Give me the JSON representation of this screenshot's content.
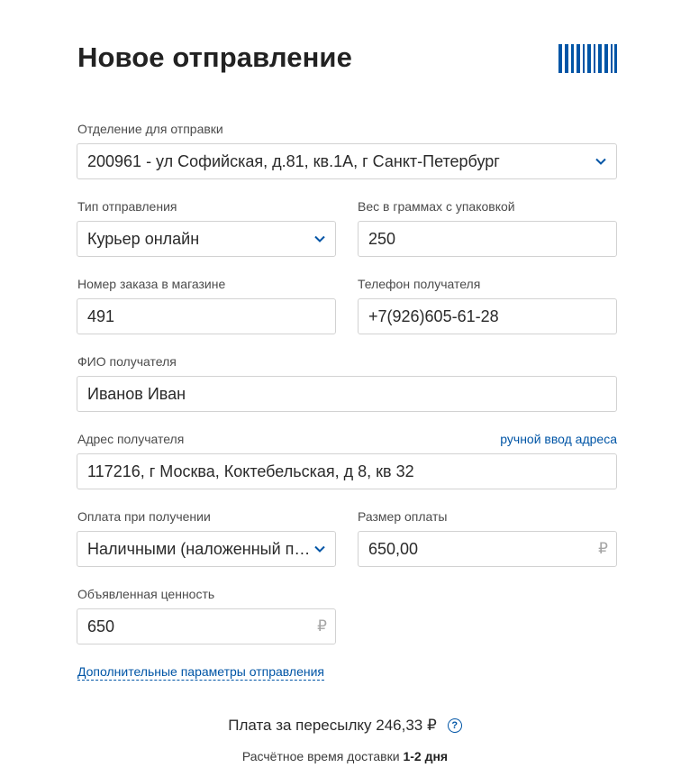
{
  "header": {
    "title": "Новое отправление"
  },
  "form": {
    "branch": {
      "label": "Отделение для отправки",
      "value": "200961 - ул Софийская, д.81, кв.1А, г Санкт-Петербург"
    },
    "type": {
      "label": "Тип отправления",
      "value": "Курьер онлайн"
    },
    "weight": {
      "label": "Вес в граммах с упаковкой",
      "value": "250"
    },
    "order": {
      "label": "Номер заказа в магазине",
      "value": "491"
    },
    "phone": {
      "label": "Телефон получателя",
      "value": "+7(926)605-61-28"
    },
    "name": {
      "label": "ФИО получателя",
      "value": "Иванов Иван"
    },
    "address": {
      "label": "Адрес получателя",
      "manual_link": "ручной ввод адреса",
      "value": "117216, г Москва, Коктебельская, д 8, кв 32"
    },
    "cod": {
      "label": "Оплата при получении",
      "value": "Наличными (наложенный платёж)"
    },
    "cod_amount": {
      "label": "Размер оплаты",
      "value": "650,00",
      "currency": "₽"
    },
    "declared": {
      "label": "Объявленная ценность",
      "value": "650",
      "currency": "₽"
    },
    "extra_link": "Дополнительные параметры отправления"
  },
  "summary": {
    "fee_text": "Плата за пересылку 246,33 ₽",
    "help_symbol": "?",
    "eta_prefix": "Расчётное время доставки",
    "eta_value": "1-2 дня"
  },
  "colors": {
    "accent": "#0055a6",
    "border": "#d2d2d2"
  }
}
